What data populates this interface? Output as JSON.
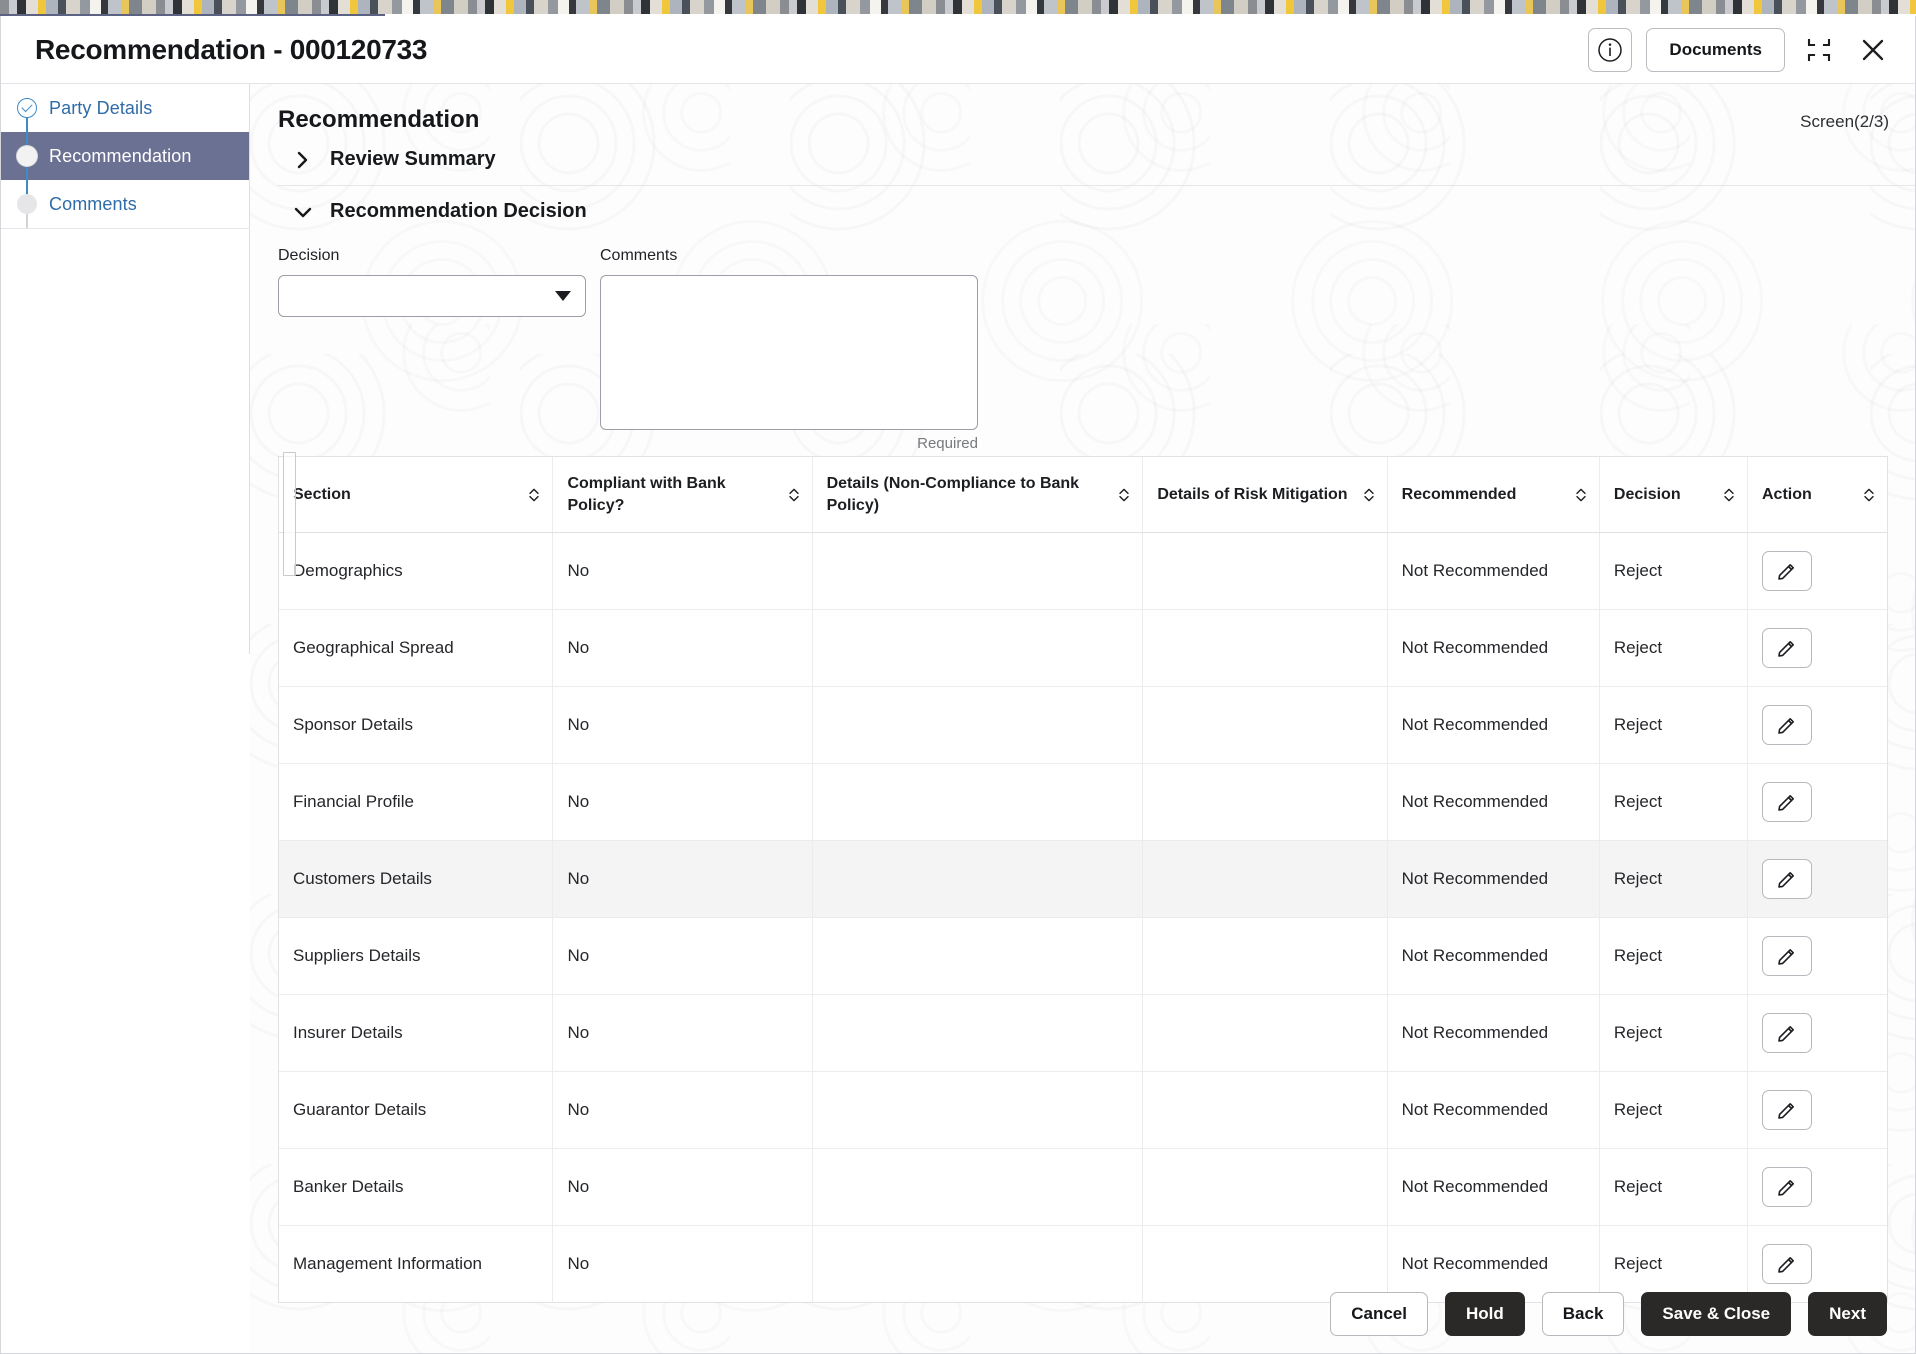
{
  "window": {
    "title": "Recommendation - 000120733",
    "info_icon": "info-circle-icon",
    "documents_label": "Documents",
    "minimize_icon": "collapse-corners-icon",
    "close_icon": "close-x-icon"
  },
  "sidebar": {
    "steps": [
      {
        "label": "Party Details",
        "state": "done"
      },
      {
        "label": "Recommendation",
        "state": "current"
      },
      {
        "label": "Comments",
        "state": "pending"
      }
    ]
  },
  "main": {
    "title": "Recommendation",
    "screen_indicator": "Screen(2/3)",
    "sections": [
      {
        "label": "Review Summary",
        "expanded": false
      },
      {
        "label": "Recommendation Decision",
        "expanded": true
      }
    ]
  },
  "form": {
    "decision": {
      "label": "Decision",
      "value": "",
      "placeholder": ""
    },
    "comments": {
      "label": "Comments",
      "value": "",
      "placeholder": "",
      "hint": "Required"
    }
  },
  "table": {
    "columns": [
      "Section",
      "Compliant with Bank Policy?",
      "Details (Non-Compliance to Bank Policy)",
      "Details of Risk Mitigation",
      "Recommended",
      "Decision",
      "Action"
    ],
    "rows": [
      {
        "section": "Demographics",
        "compliant": "No",
        "details": "",
        "risk": "",
        "recommended": "Not Recommended",
        "decision": "Reject",
        "action_icon": "pencil-edit-icon",
        "highlighted": false
      },
      {
        "section": "Geographical Spread",
        "compliant": "No",
        "details": "",
        "risk": "",
        "recommended": "Not Recommended",
        "decision": "Reject",
        "action_icon": "pencil-edit-icon",
        "highlighted": false
      },
      {
        "section": "Sponsor Details",
        "compliant": "No",
        "details": "",
        "risk": "",
        "recommended": "Not Recommended",
        "decision": "Reject",
        "action_icon": "pencil-edit-icon",
        "highlighted": false
      },
      {
        "section": "Financial Profile",
        "compliant": "No",
        "details": "",
        "risk": "",
        "recommended": "Not Recommended",
        "decision": "Reject",
        "action_icon": "pencil-edit-icon",
        "highlighted": false
      },
      {
        "section": "Customers Details",
        "compliant": "No",
        "details": "",
        "risk": "",
        "recommended": "Not Recommended",
        "decision": "Reject",
        "action_icon": "pencil-edit-icon",
        "highlighted": true
      },
      {
        "section": "Suppliers Details",
        "compliant": "No",
        "details": "",
        "risk": "",
        "recommended": "Not Recommended",
        "decision": "Reject",
        "action_icon": "pencil-edit-icon",
        "highlighted": false
      },
      {
        "section": "Insurer Details",
        "compliant": "No",
        "details": "",
        "risk": "",
        "recommended": "Not Recommended",
        "decision": "Reject",
        "action_icon": "pencil-edit-icon",
        "highlighted": false
      },
      {
        "section": "Guarantor Details",
        "compliant": "No",
        "details": "",
        "risk": "",
        "recommended": "Not Recommended",
        "decision": "Reject",
        "action_icon": "pencil-edit-icon",
        "highlighted": false
      },
      {
        "section": "Banker Details",
        "compliant": "No",
        "details": "",
        "risk": "",
        "recommended": "Not Recommended",
        "decision": "Reject",
        "action_icon": "pencil-edit-icon",
        "highlighted": false
      },
      {
        "section": "Management Information",
        "compliant": "No",
        "details": "",
        "risk": "",
        "recommended": "Not Recommended",
        "decision": "Reject",
        "action_icon": "pencil-edit-icon",
        "highlighted": false
      }
    ]
  },
  "footer": {
    "buttons": [
      {
        "label": "Cancel",
        "style": "outline"
      },
      {
        "label": "Hold",
        "style": "dark"
      },
      {
        "label": "Back",
        "style": "outline"
      },
      {
        "label": "Save & Close",
        "style": "dark"
      },
      {
        "label": "Next",
        "style": "dark"
      }
    ]
  },
  "colors": {
    "active_step_bg": "#6a7192",
    "step_link": "#2f6ca8",
    "step_done_accent": "#3b8cc9",
    "dark_button": "#2b2927",
    "row_highlight": "#f4f4f5"
  }
}
